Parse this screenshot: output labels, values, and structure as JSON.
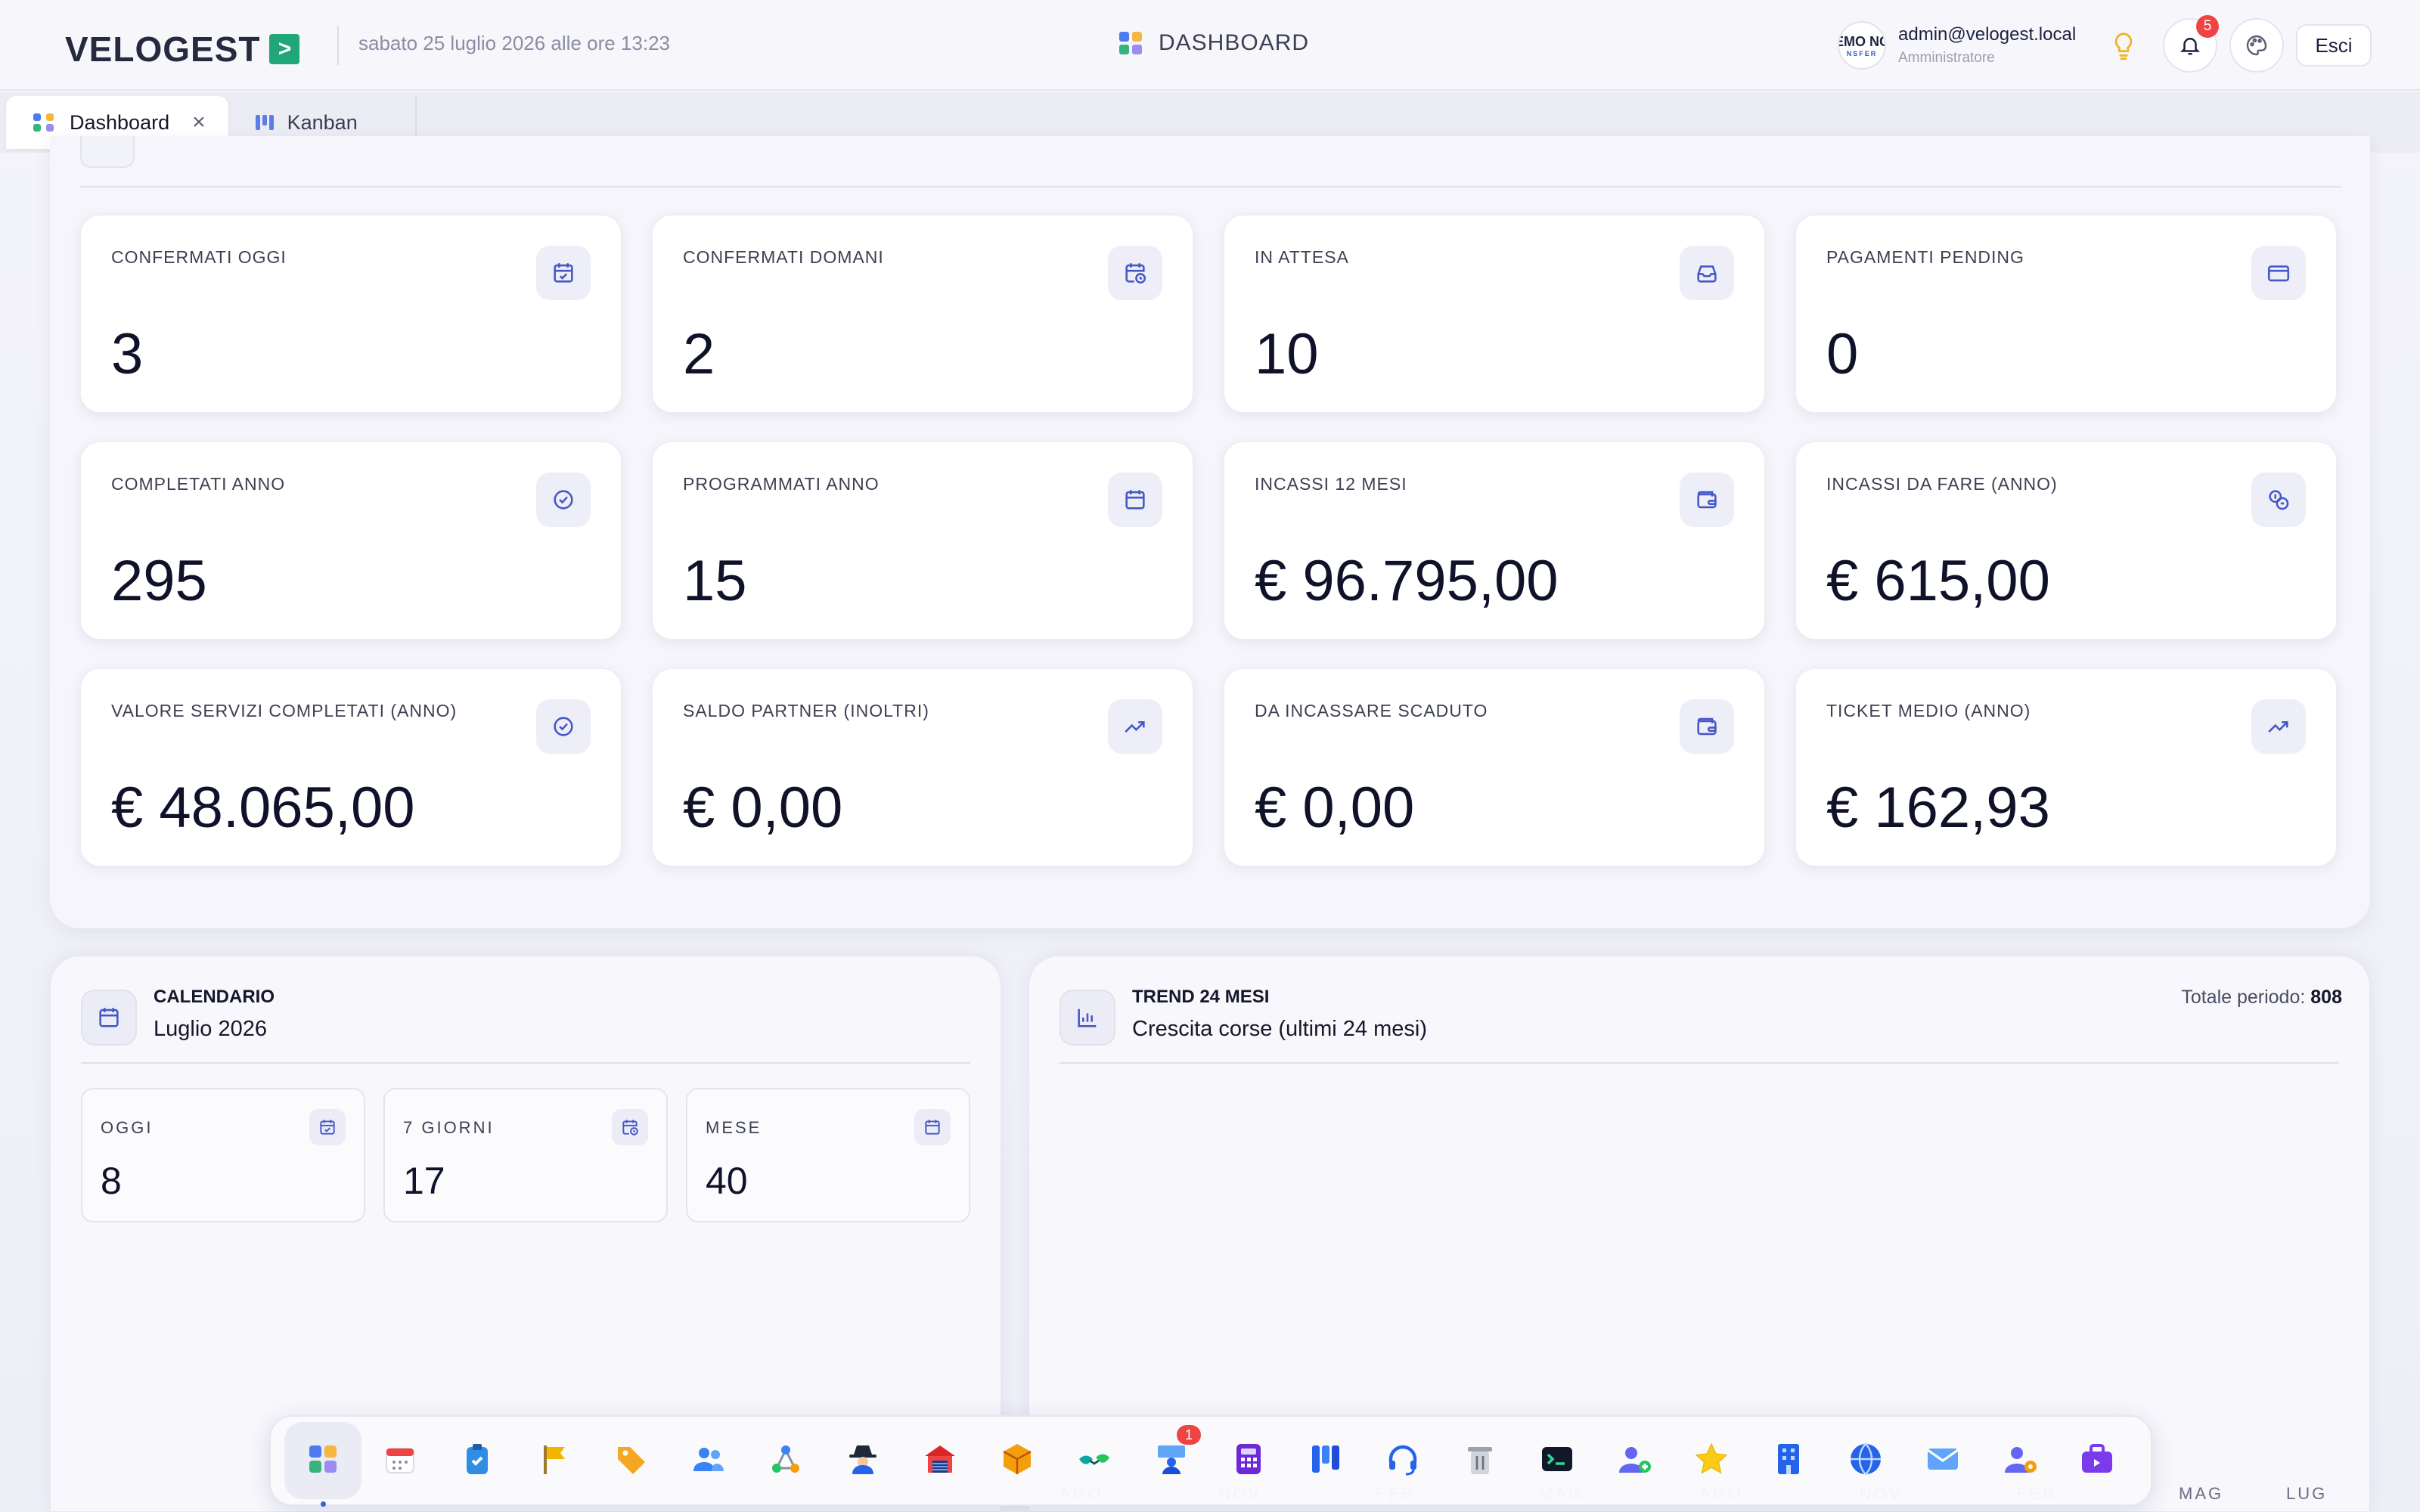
{
  "header": {
    "brand": "VELOGEST",
    "brand_mark": ">",
    "datetime": "sabato 25 luglio 2026 alle ore 13:23",
    "page_title": "DASHBOARD",
    "avatar_line1": "EMO NC",
    "avatar_line2": "NSFER",
    "user_email": "admin@velogest.local",
    "user_role": "Amministratore",
    "notifications_count": "5",
    "logout_label": "Esci"
  },
  "tabs": [
    {
      "label": "Dashboard",
      "close": "×"
    },
    {
      "label": "Kanban"
    }
  ],
  "kpis": [
    {
      "label": "CONFERMATI OGGI",
      "value": "3",
      "icon": "calendar-check-icon"
    },
    {
      "label": "CONFERMATI DOMANI",
      "value": "2",
      "icon": "calendar-clock-icon"
    },
    {
      "label": "IN ATTESA",
      "value": "10",
      "icon": "inbox-icon"
    },
    {
      "label": "PAGAMENTI PENDING",
      "value": "0",
      "icon": "credit-card-icon"
    },
    {
      "label": "COMPLETATI ANNO",
      "value": "295",
      "icon": "check-circle-icon"
    },
    {
      "label": "PROGRAMMATI ANNO",
      "value": "15",
      "icon": "calendar-grid-icon"
    },
    {
      "label": "INCASSI 12 MESI",
      "value": "€ 96.795,00",
      "icon": "wallet-icon"
    },
    {
      "label": "INCASSI DA FARE (ANNO)",
      "value": "€ 615,00",
      "icon": "coins-icon"
    },
    {
      "label": "VALORE SERVIZI COMPLETATI (ANNO)",
      "value": "€ 48.065,00",
      "icon": "check-circle-icon"
    },
    {
      "label": "SALDO PARTNER (INOLTRI)",
      "value": "€ 0,00",
      "icon": "trending-up-icon"
    },
    {
      "label": "DA INCASSARE SCADUTO",
      "value": "€ 0,00",
      "icon": "wallet-icon"
    },
    {
      "label": "TICKET MEDIO (ANNO)",
      "value": "€ 162,93",
      "icon": "trending-up-icon"
    }
  ],
  "calendar": {
    "kicker": "CALENDARIO",
    "title": "Luglio 2026",
    "cards": [
      {
        "label": "OGGI",
        "value": "8"
      },
      {
        "label": "7 GIORNI",
        "value": "17"
      },
      {
        "label": "MESE",
        "value": "40"
      }
    ]
  },
  "trend": {
    "kicker": "TREND 24 MESI",
    "title": "Crescita corse (ultimi 24 mesi)",
    "total_label": "Totale periodo:",
    "total_value": "808"
  },
  "chart_data": {
    "type": "line",
    "title": "Crescita corse (ultimi 24 mesi)",
    "x_tick_labels": [
      "AGO",
      "NOV",
      "FEB",
      "MAG",
      "AGO",
      "NOV",
      "FEB",
      "MAG",
      "LUG"
    ],
    "series": [],
    "total": 808
  },
  "dock": {
    "items": [
      "dashboard-grid-icon",
      "calendar-icon",
      "clipboard-icon",
      "flag-icon",
      "tag-icon",
      "users-icon",
      "network-icon",
      "spy-icon",
      "warehouse-icon",
      "package-icon",
      "handshake-icon",
      "presenter-icon",
      "calculator-icon",
      "kanban-icon",
      "headset-icon",
      "trash-icon",
      "terminal-icon",
      "user-add-icon",
      "star-icon",
      "building-icon",
      "globe-icon",
      "mail-icon",
      "user-settings-icon",
      "briefcase-icon"
    ],
    "badge": "1",
    "colors": {
      "accent": "#3a5fd6",
      "badge": "#ef4444",
      "brand_green": "#21a67a"
    }
  }
}
